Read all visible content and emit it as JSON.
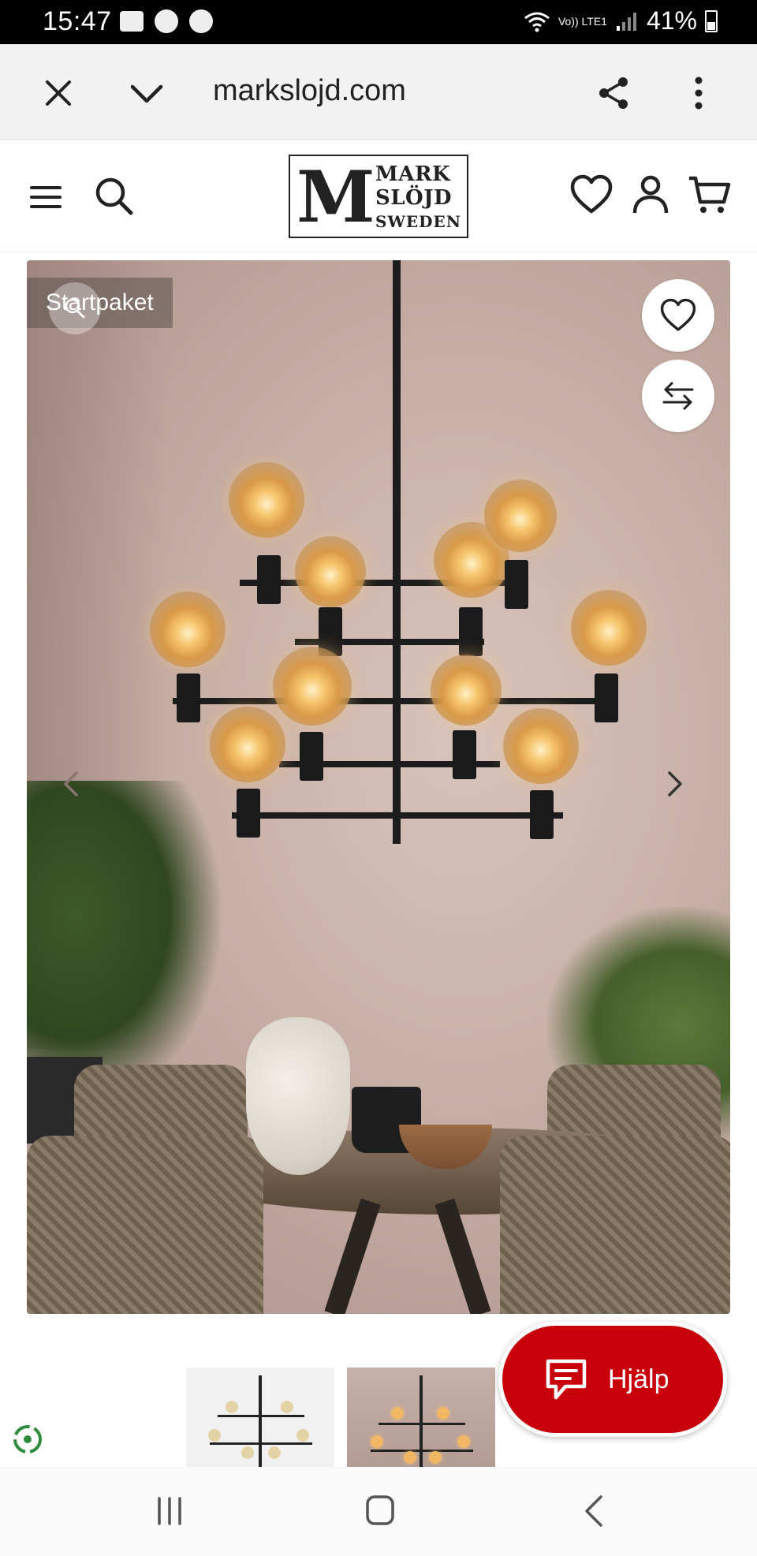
{
  "status_bar": {
    "time": "15:47",
    "network_label": "Vo)) LTE1",
    "battery": "41%"
  },
  "browser": {
    "url": "markslojd.com"
  },
  "site": {
    "logo_lines": [
      "MARK",
      "SLÖJD",
      "SWEDEN"
    ],
    "logo_initial": "M"
  },
  "product": {
    "badge": "Startpaket"
  },
  "help_button": {
    "label": "Hjälp"
  },
  "colors": {
    "help_red": "#c8000a",
    "status_bar": "#000000",
    "browser_bar": "#f2f2f2"
  }
}
